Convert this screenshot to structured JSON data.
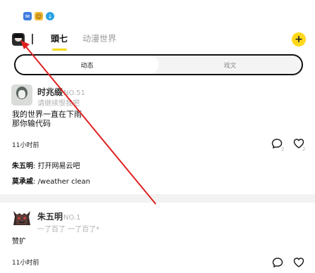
{
  "status_bar": {
    "icons": [
      "app-notification-icon",
      "cat-app-icon",
      "download-icon"
    ]
  },
  "header": {
    "tab_active": "頭七",
    "tab_secondary": "动漫世界",
    "add_symbol": "+"
  },
  "segment": {
    "active_label": "动态",
    "inactive_label": "戏文"
  },
  "posts": [
    {
      "author": "时兆缀",
      "level": "NO.51",
      "signature": "请继续恨我吧",
      "content_line1": "我的世界一直在下雨",
      "content_line2": "那你输代码",
      "time": "11小时前",
      "comment_count": "2",
      "like_count": "2",
      "replies": [
        {
          "name": "朱五明",
          "text": "打开网易云吧"
        },
        {
          "name": "莫承戚",
          "text": "/weather clean"
        }
      ]
    },
    {
      "author": "朱五明",
      "level": "NO.1",
      "signature": "一了百了 一了百了*",
      "content": "赞扩",
      "time": "11小时前"
    }
  ],
  "colors": {
    "accent_yellow": "#ffd81a",
    "annotation_red": "#e02020"
  }
}
